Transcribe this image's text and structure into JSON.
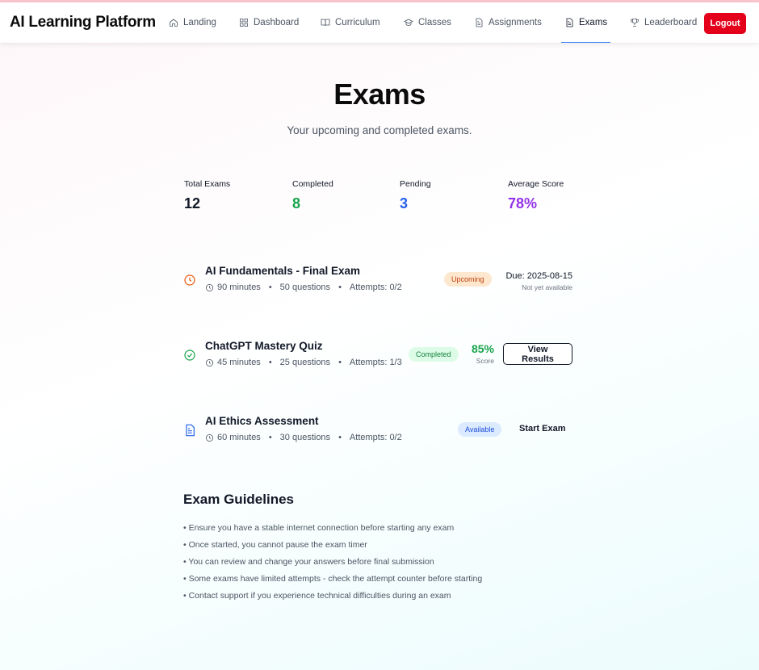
{
  "app": {
    "brand": "AI Learning Platform"
  },
  "nav": {
    "items": [
      {
        "label": "Landing",
        "icon": "home-icon"
      },
      {
        "label": "Dashboard",
        "icon": "dashboard-icon"
      },
      {
        "label": "Curriculum",
        "icon": "book-icon"
      },
      {
        "label": "Classes",
        "icon": "graduation-cap-icon"
      },
      {
        "label": "Assignments",
        "icon": "document-icon"
      },
      {
        "label": "Exams",
        "icon": "document-icon",
        "active": true
      },
      {
        "label": "Leaderboard",
        "icon": "trophy-icon"
      }
    ],
    "logout_label": "Logout"
  },
  "page": {
    "title": "Exams",
    "subtitle": "Your upcoming and completed exams."
  },
  "stats": [
    {
      "label": "Total Exams",
      "value": "12",
      "color": "#111827"
    },
    {
      "label": "Completed",
      "value": "8",
      "color": "#16a34a"
    },
    {
      "label": "Pending",
      "value": "3",
      "color": "#2563eb"
    },
    {
      "label": "Average Score",
      "value": "78%",
      "color": "#9333ea"
    }
  ],
  "exams": [
    {
      "title": "AI Fundamentals - Final Exam",
      "duration": "90 minutes",
      "questions": "50 questions",
      "attempts": "Attempts: 0/2",
      "status": "Upcoming",
      "status_icon": "clock-icon",
      "due": "Due: 2025-08-15",
      "due_note": "Not yet available"
    },
    {
      "title": "ChatGPT Mastery Quiz",
      "duration": "45 minutes",
      "questions": "25 questions",
      "attempts": "Attempts: 1/3",
      "status": "Completed",
      "status_icon": "check-circle-icon",
      "score": "85%",
      "score_label": "Score",
      "action": "View Results"
    },
    {
      "title": "AI Ethics Assessment",
      "duration": "60 minutes",
      "questions": "30 questions",
      "attempts": "Attempts: 0/2",
      "status": "Available",
      "status_icon": "document-icon",
      "action": "Start Exam"
    }
  ],
  "separator": "•",
  "guidelines": {
    "title": "Exam Guidelines",
    "items": [
      "• Ensure you have a stable internet connection before starting any exam",
      "• Once started, you cannot pause the exam timer",
      "• You can review and change your answers before final submission",
      "• Some exams have limited attempts - check the attempt counter before starting",
      "• Contact support if you experience technical difficulties during an exam"
    ]
  },
  "colors": {
    "accent_red": "#e4001b",
    "active_underline": "#3b82f6",
    "upcoming": "#ea580c",
    "completed": "#16a34a",
    "available": "#2563eb"
  }
}
